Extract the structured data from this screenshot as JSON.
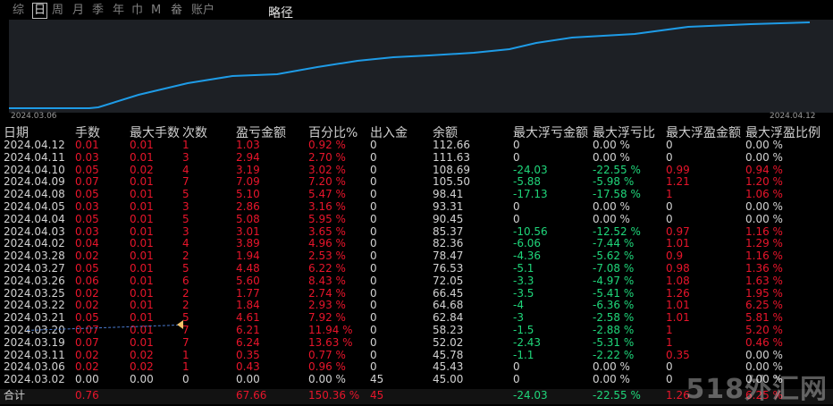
{
  "tabs": [
    "综",
    "日",
    "周",
    "月",
    "季",
    "年",
    "巾",
    "M",
    "畚",
    "账户"
  ],
  "active_tab": "日",
  "chart_title": "略径",
  "chart_dates": {
    "start": "2024.03.06",
    "end": "2024.04.12"
  },
  "headers": [
    "日期",
    "手数",
    "最大手数",
    "次数",
    "盈亏金额",
    "百分比%",
    "出入金",
    "余额",
    "最大浮亏金额",
    "最大浮亏比",
    "最大浮盈金额",
    "最大浮盈比例"
  ],
  "rows": [
    [
      "2024.04.12",
      "0.01",
      "0.01",
      "1",
      "1.03",
      "0.92 %",
      "0",
      "112.66",
      "0",
      "0.00 %",
      "0",
      "0.00 %"
    ],
    [
      "2024.04.11",
      "0.03",
      "0.01",
      "3",
      "2.94",
      "2.70 %",
      "0",
      "111.63",
      "0",
      "0.00 %",
      "0",
      "0.00 %"
    ],
    [
      "2024.04.10",
      "0.05",
      "0.02",
      "4",
      "3.19",
      "3.02 %",
      "0",
      "108.69",
      "-24.03",
      "-22.55 %",
      "0.99",
      "0.94 %"
    ],
    [
      "2024.04.09",
      "0.07",
      "0.01",
      "7",
      "7.09",
      "7.20 %",
      "0",
      "105.50",
      "-5.88",
      "-5.98 %",
      "1.21",
      "1.20 %"
    ],
    [
      "2024.04.08",
      "0.05",
      "0.01",
      "5",
      "5.10",
      "5.47 %",
      "0",
      "98.41",
      "-17.13",
      "-17.58 %",
      "1",
      "1.06 %"
    ],
    [
      "2024.04.05",
      "0.03",
      "0.01",
      "3",
      "2.86",
      "3.16 %",
      "0",
      "93.31",
      "0",
      "0.00 %",
      "0",
      "0.00 %"
    ],
    [
      "2024.04.04",
      "0.05",
      "0.01",
      "5",
      "5.08",
      "5.95 %",
      "0",
      "90.45",
      "0",
      "0.00 %",
      "0",
      "0.00 %"
    ],
    [
      "2024.04.03",
      "0.03",
      "0.01",
      "3",
      "3.01",
      "3.65 %",
      "0",
      "85.37",
      "-10.56",
      "-12.52 %",
      "0.97",
      "1.16 %"
    ],
    [
      "2024.04.02",
      "0.04",
      "0.01",
      "4",
      "3.89",
      "4.96 %",
      "0",
      "82.36",
      "-6.06",
      "-7.44 %",
      "1.01",
      "1.29 %"
    ],
    [
      "2024.03.28",
      "0.02",
      "0.01",
      "2",
      "1.94",
      "2.53 %",
      "0",
      "78.47",
      "-4.36",
      "-5.62 %",
      "0.9",
      "1.16 %"
    ],
    [
      "2024.03.27",
      "0.05",
      "0.01",
      "5",
      "4.48",
      "6.22 %",
      "0",
      "76.53",
      "-5.1",
      "-7.08 %",
      "0.98",
      "1.36 %"
    ],
    [
      "2024.03.26",
      "0.06",
      "0.01",
      "6",
      "5.60",
      "8.43 %",
      "0",
      "72.05",
      "-3.3",
      "-4.97 %",
      "1.08",
      "1.63 %"
    ],
    [
      "2024.03.25",
      "0.02",
      "0.01",
      "2",
      "1.77",
      "2.74 %",
      "0",
      "66.45",
      "-3.5",
      "-5.41 %",
      "1.26",
      "1.95 %"
    ],
    [
      "2024.03.22",
      "0.02",
      "0.01",
      "2",
      "1.84",
      "2.93 %",
      "0",
      "64.68",
      "-4",
      "-6.36 %",
      "1.01",
      "6.25 %"
    ],
    [
      "2024.03.21",
      "0.05",
      "0.01",
      "5",
      "4.61",
      "7.92 %",
      "0",
      "62.84",
      "-3",
      "-2.58 %",
      "1.01",
      "5.81 %"
    ],
    [
      "2024.03.20",
      "0.07",
      "0.01",
      "7",
      "6.21",
      "11.94 %",
      "0",
      "58.23",
      "-1.5",
      "-2.88 %",
      "1",
      "5.20 %"
    ],
    [
      "2024.03.19",
      "0.07",
      "0.01",
      "7",
      "6.24",
      "13.63 %",
      "0",
      "52.02",
      "-2.43",
      "-5.31 %",
      "1",
      "0.46 %"
    ],
    [
      "2024.03.11",
      "0.02",
      "0.02",
      "1",
      "0.35",
      "0.77 %",
      "0",
      "45.78",
      "-1.1",
      "-2.22 %",
      "0.35",
      "0.00 %"
    ],
    [
      "2024.03.06",
      "0.02",
      "0.02",
      "1",
      "0.43",
      "0.96 %",
      "0",
      "45.43",
      "0",
      "0.00 %",
      "0",
      "0.00 %"
    ],
    [
      "2024.03.02",
      "0.00",
      "0.00",
      "0",
      "0.00",
      "0.00 %",
      "45",
      "45.00",
      "0",
      "0.00 %",
      "0",
      "0.00 %"
    ]
  ],
  "total": [
    "合计",
    "0.76",
    "",
    "",
    "67.66",
    "150.36 %",
    "45",
    "",
    "-24.03",
    "-22.55 %",
    "1.26",
    "6.25 %"
  ],
  "line_color": "#1e9be6",
  "watermark": "518外汇网"
}
